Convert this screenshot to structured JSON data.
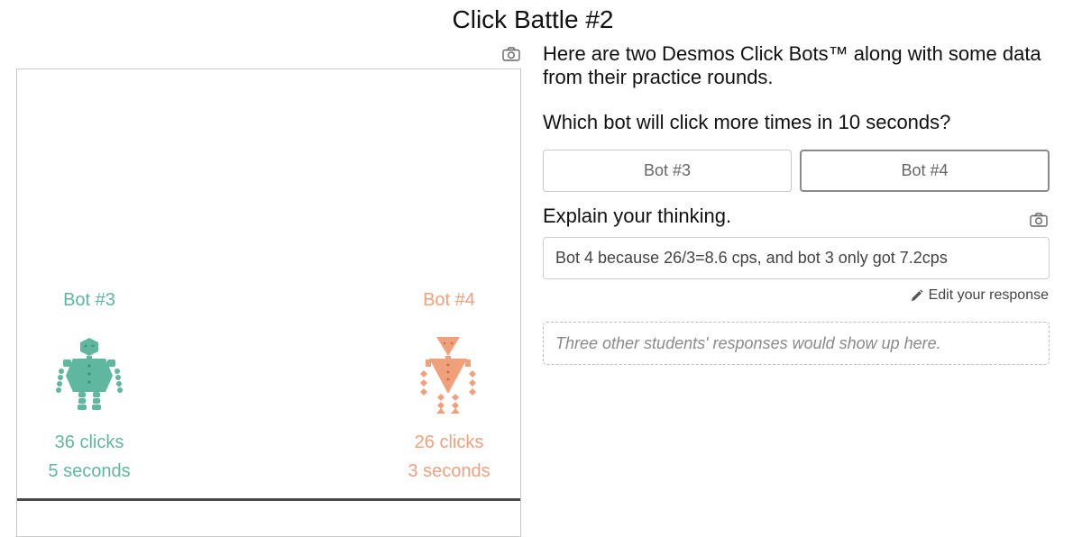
{
  "page": {
    "title": "Click Battle #2"
  },
  "icons": {
    "camera": "camera-icon",
    "pencil": "pencil-icon"
  },
  "colors": {
    "teal_bot": "#5fb79f",
    "orange_bot": "#f0a07a"
  },
  "bots": [
    {
      "label": "Bot #3",
      "clicks": "36 clicks",
      "time": "5 seconds",
      "color": "#5fb79f"
    },
    {
      "label": "Bot #4",
      "clicks": "26 clicks",
      "time": "3 seconds",
      "color": "#f0a07a"
    }
  ],
  "question": {
    "intro": "Here are two Desmos Click Bots™ along with some data from their practice rounds.",
    "prompt": "Which bot will click more times in 10 seconds?",
    "choices": [
      "Bot #3",
      "Bot #4"
    ],
    "selected": "Bot #4"
  },
  "explain": {
    "prompt": "Explain your thinking.",
    "response": "Bot 4 because 26/3=8.6 cps, and bot 3 only got 7.2cps",
    "edit_label": "Edit your response",
    "others_placeholder": "Three other students' responses would show up here."
  }
}
